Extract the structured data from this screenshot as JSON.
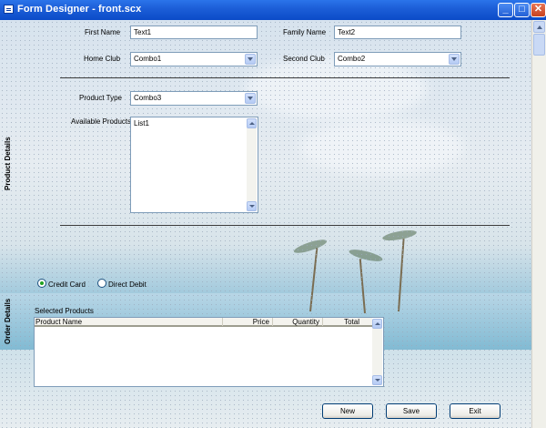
{
  "window": {
    "title": "Form Designer - front.scx"
  },
  "form": {
    "first_name": {
      "label": "First Name",
      "value": "Text1"
    },
    "family_name": {
      "label": "Family Name",
      "value": "Text2"
    },
    "home_club": {
      "label": "Home Club",
      "value": "Combo1"
    },
    "second_club": {
      "label": "Second Club",
      "value": "Combo2"
    },
    "product_type": {
      "label": "Product Type",
      "value": "Combo3"
    },
    "available_products": {
      "label": "Available Products",
      "items": [
        "List1"
      ]
    }
  },
  "sections": {
    "product_details": "Product Details",
    "order_details": "Order Details"
  },
  "payment": {
    "options": [
      {
        "label": "Credit Card",
        "selected": true
      },
      {
        "label": "Direct Debit",
        "selected": false
      }
    ]
  },
  "selected_products": {
    "label": "Selected Products",
    "columns": [
      "Product Name",
      "Price",
      "Quantity",
      "Total"
    ]
  },
  "buttons": {
    "new": "New",
    "save": "Save",
    "exit": "Exit"
  },
  "colors": {
    "titlebar": "#1d5fd8",
    "accent_border": "#7f9db9",
    "radio_dot": "#21a121"
  }
}
